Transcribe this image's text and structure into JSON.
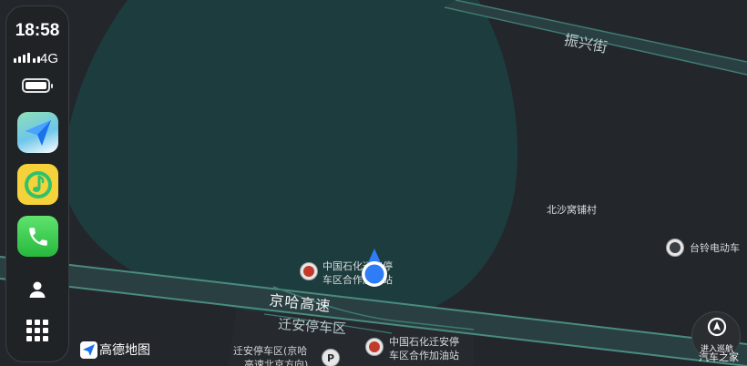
{
  "status": {
    "time": "18:58",
    "network": "4G"
  },
  "sidebar": {
    "apps": [
      {
        "name": "高德地图",
        "icon": "map-navigation-icon"
      },
      {
        "name": "QQ音乐",
        "icon": "music-note-icon"
      },
      {
        "name": "电话",
        "icon": "phone-icon"
      }
    ],
    "profile_icon": "person-icon",
    "app_grid_icon": "grid-icon"
  },
  "map": {
    "roads": {
      "expressway": "京哈高速",
      "upper_street": "振兴街",
      "service_area": "迁安停车区"
    },
    "places": {
      "village": "北沙窝铺村",
      "ev_shop": "台铃电动车",
      "station_north_line1": "中国石化迁安停",
      "station_north_line2": "车区合作加油站",
      "station_south_line1": "中国石化迁安停",
      "station_south_line2": "车区合作加油站",
      "parking_line1": "迁安停车区(京哈",
      "parking_line2": "高速北京方向)"
    },
    "logo_text": "高德地图",
    "nav_button_label": "进入巡航",
    "watermark": "汽车之家"
  },
  "colors": {
    "background": "#23272b",
    "area_fill": "#1d3c3e",
    "road_fill": "#2a3f41",
    "road_edge": "#3f7a72",
    "location_blue": "#2f7df6"
  }
}
